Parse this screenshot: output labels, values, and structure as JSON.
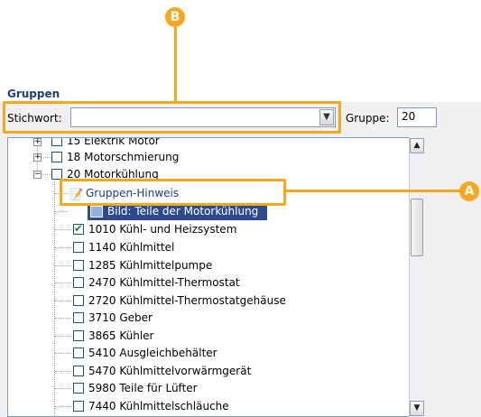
{
  "callouts": {
    "a": "A",
    "b": "B"
  },
  "panel": {
    "title": "Gruppen",
    "search_label": "Stichwort:",
    "search_value": "",
    "group_label": "Gruppe:",
    "group_value": "20"
  },
  "tree": {
    "top_partial": "15 Elektrik Motor",
    "motor": "18 Motorschmierung",
    "cooling": "20 Motorkühlung",
    "hint": "Gruppen-Hinweis",
    "image": "Bild: Teile der Motorkühlung",
    "items": [
      "1010 Kühl- und Heizsystem",
      "1140 Kühlmittel",
      "1285 Kühlmittelpumpe",
      "2470 Kühlmittel-Thermostat",
      "2720 Kühlmittel-Thermostatgehäuse",
      "3710 Geber",
      "3865 Kühler",
      "5410 Ausgleichbehälter",
      "5470 Kühlmittelvorwärmgerät",
      "5980 Teile für Lüfter",
      "7440 Kühlmittelschläuche"
    ]
  },
  "colors": {
    "accent": "#f5a81c",
    "selection": "#2d4a8f",
    "title": "#1f3f7a"
  }
}
